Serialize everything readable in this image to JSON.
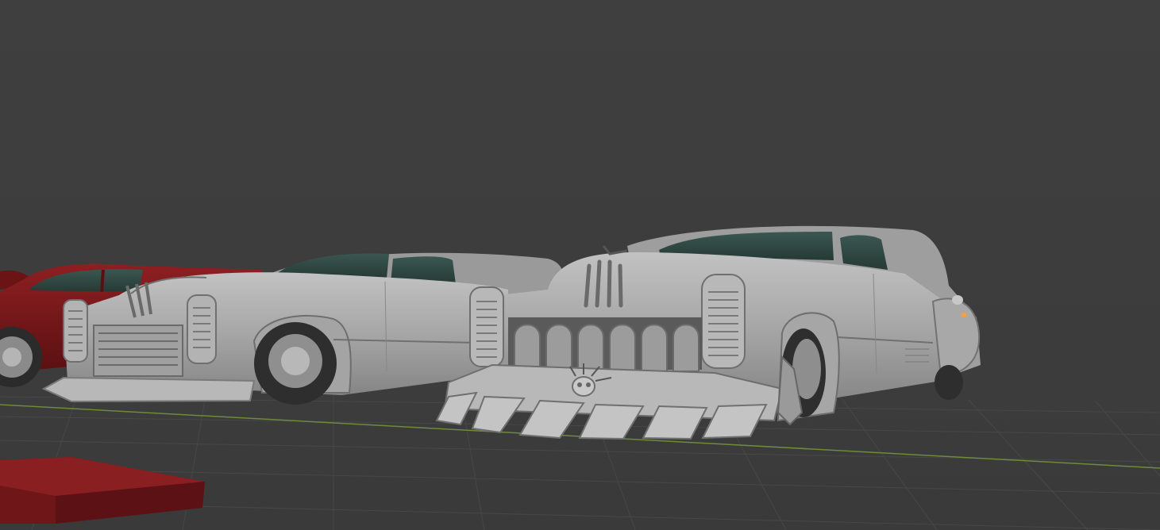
{
  "app": "3D viewport",
  "colors": {
    "background": "#3d3d3d",
    "grid": "#474747",
    "x_axis": "#6e8a3a",
    "car_gray": "#a9a9a9",
    "car_dark": "#7d7d7d",
    "glass": "#2f4640",
    "red_body": "#7a1a1c",
    "origin_dot": "#f2a040"
  },
  "objects": [
    {
      "name": "red-sedan",
      "kind": "car-model",
      "material": "red"
    },
    {
      "name": "hotrod-wagon-left",
      "kind": "car-model",
      "material": "clay"
    },
    {
      "name": "hotrod-wagon-right",
      "kind": "car-model",
      "material": "clay"
    },
    {
      "name": "red-slab",
      "kind": "box",
      "material": "red"
    }
  ]
}
